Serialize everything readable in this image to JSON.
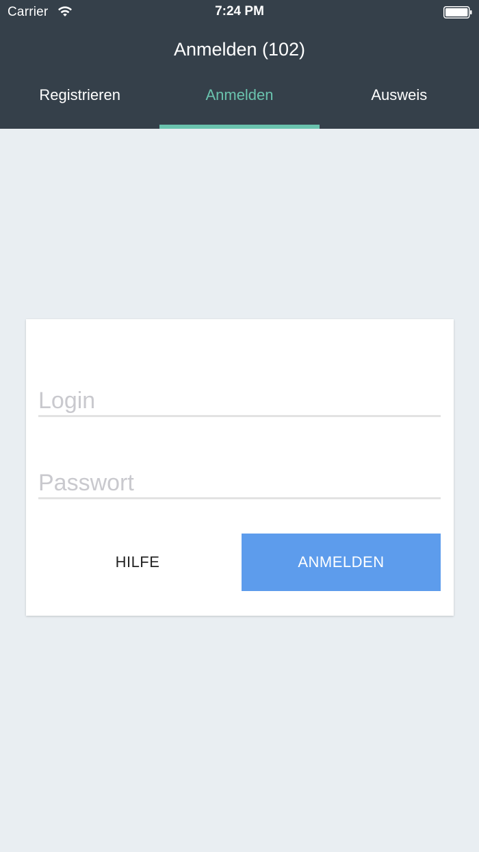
{
  "status_bar": {
    "carrier": "Carrier",
    "time": "7:24 PM",
    "icons": [
      "wifi-icon",
      "battery-icon"
    ]
  },
  "header": {
    "title": "Anmelden (102)"
  },
  "tabs": [
    {
      "label": "Registrieren",
      "active": false
    },
    {
      "label": "Anmelden",
      "active": true
    },
    {
      "label": "Ausweis",
      "active": false
    }
  ],
  "form": {
    "login": {
      "placeholder": "Login",
      "value": ""
    },
    "password": {
      "placeholder": "Passwort",
      "value": ""
    },
    "help_label": "HILFE",
    "submit_label": "ANMELDEN"
  },
  "colors": {
    "header_bg": "#35404a",
    "accent": "#6ac3ae",
    "page_bg": "#e9eef2",
    "button_primary": "#5d9cec"
  }
}
